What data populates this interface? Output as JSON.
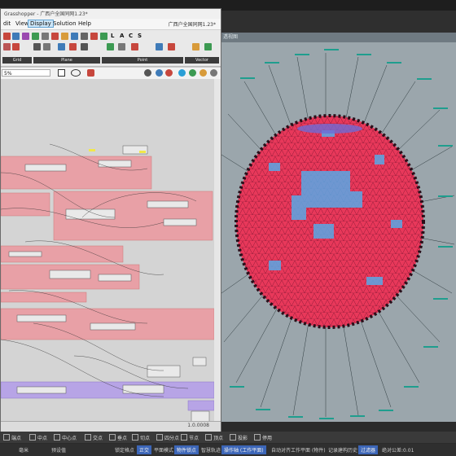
{
  "gh": {
    "title": "Grasshopper - 广西户全国同网1.23*",
    "file_label": "广西户全国同网1.23*",
    "menu": [
      "dit",
      "View",
      "Display",
      "Solution",
      "Help"
    ],
    "active_menu": "Display",
    "ribbon_letters": [
      "L",
      "A",
      "C",
      "S"
    ],
    "ribbon_groups": [
      "Grid",
      "Plane",
      "Point",
      "Vector"
    ],
    "zoom": "5%",
    "status_value": "1.0.0008"
  },
  "rhino": {
    "viewport_label": "透视图"
  },
  "snaps": [
    "端点",
    "中点",
    "中心点",
    "交点",
    "垂点",
    "切点",
    "四分点",
    "节点",
    "顶点",
    "投影",
    "停用"
  ],
  "statusbar": {
    "unit": "毫米",
    "layer": "预设值",
    "buttons": [
      {
        "label": "锁定格点",
        "on": false
      },
      {
        "label": "正交",
        "on": true
      },
      {
        "label": "平面模式",
        "on": false
      },
      {
        "label": "物件锁点",
        "on": true
      },
      {
        "label": "智慧轨迹",
        "on": false
      },
      {
        "label": "操作轴 (工作平面)",
        "on": true
      },
      {
        "label": "自动对齐工作平面 (物件)",
        "on": false
      },
      {
        "label": "记录建构历史",
        "on": false
      },
      {
        "label": "过滤器",
        "on": true
      },
      {
        "label": "绝对公差:0.01",
        "on": false
      }
    ]
  },
  "colors": {
    "group_pink": "#e8a0a6",
    "group_purple": "#b7a4e6",
    "dome_pink": "#e8385a",
    "dome_blue": "#5aa8e6",
    "annot_text": "#1f9e8e",
    "accent_blue": "#3c66b8"
  }
}
